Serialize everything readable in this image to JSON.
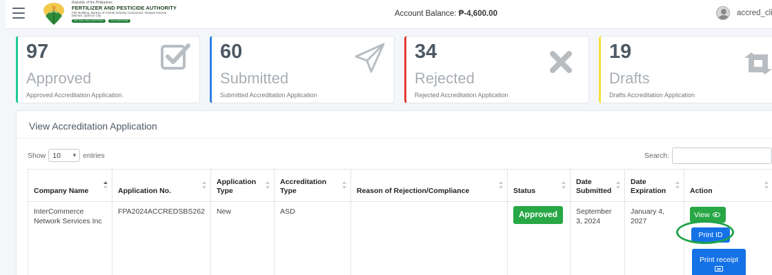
{
  "header": {
    "brand": {
      "republic": "Republic of the Philippines",
      "authority": "FERTILIZER AND PESTICIDE AUTHORITY",
      "address": "FPA Building, Bureau of Animal Industry Compound, Visayas Avenue, Diliman, Quezon City",
      "tag_iso": "ISO 9001:2015 CERTIFIED",
      "tag_cert": "TÜV CERTIFIED"
    },
    "balance_label": "Account Balance:",
    "balance_value": "₱-4,600.00",
    "username": "accred_client",
    "colors": {
      "brand_green": "#1f7a33"
    }
  },
  "stats": {
    "approved": {
      "count": "97",
      "label": "Approved",
      "desc": "Approved Accreditation Application.",
      "icon": "check-square-icon",
      "color": "#20c997"
    },
    "submitted": {
      "count": "60",
      "label": "Submitted",
      "desc": "Submitted Accreditation Application",
      "icon": "paper-plane-icon",
      "color": "#2f7ee6"
    },
    "rejected": {
      "count": "34",
      "label": "Rejected",
      "desc": "Rejected Accreditation Application",
      "icon": "x-icon",
      "color": "#e53935"
    },
    "drafts": {
      "count": "19",
      "label": "Drafts",
      "desc": "Drafts Accreditation Application",
      "icon": "retweet-icon",
      "color": "#f5e13a"
    }
  },
  "panel": {
    "title": "View Accreditation Application",
    "show_label": "Show",
    "entries_value": "10",
    "entries_label": "entries",
    "search_label": "Search:",
    "search_value": ""
  },
  "table": {
    "columns": [
      "Company Name",
      "Application No.",
      "Application Type",
      "Accreditation Type",
      "Reason of Rejection/Compliance",
      "Status",
      "Date Submitted",
      "Date Expiration",
      "Action"
    ],
    "rows": [
      {
        "company": "InterCommerce Network Services Inc",
        "application_no": "FPA2024ACCREDSBS262",
        "application_type": "New",
        "accreditation_type": "ASD",
        "reason": "",
        "status": "Approved",
        "date_submitted": "September 3, 2024",
        "date_expiration": "January 4, 2027",
        "actions": {
          "view": "View",
          "print_id": "Print ID",
          "print_receipt": "Print receipt"
        }
      }
    ],
    "colors": {
      "status_approved": "#28a745",
      "primary_button": "#1472e6"
    }
  }
}
